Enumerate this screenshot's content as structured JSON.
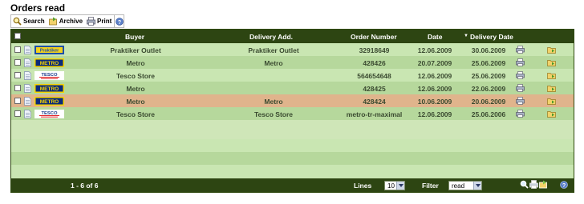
{
  "page_title": "Orders read",
  "toolbar": {
    "search_label": "Search",
    "archive_label": "Archive",
    "print_label": "Print"
  },
  "columns": {
    "buyer": "Buyer",
    "delivery_add": "Delivery Add.",
    "order_number": "Order Number",
    "date": "Date",
    "delivery_date": "Delivery Date",
    "sort_indicator": "▼"
  },
  "rows": [
    {
      "logo": "praktiker",
      "buyer": "Praktiker Outlet",
      "delivery_add": "Praktiker Outlet",
      "order_number": "32918649",
      "date": "12.06.2009",
      "delivery_date": "30.06.2009",
      "bg": "#c9e6b2"
    },
    {
      "logo": "metro",
      "buyer": "Metro",
      "delivery_add": "Metro",
      "order_number": "428426",
      "date": "20.07.2009",
      "delivery_date": "25.06.2009",
      "bg": "#b6d89c"
    },
    {
      "logo": "tesco",
      "buyer": "Tesco Store",
      "delivery_add": "",
      "order_number": "564654648",
      "date": "12.06.2009",
      "delivery_date": "25.06.2009",
      "bg": "#c9e6b2"
    },
    {
      "logo": "metro",
      "buyer": "Metro",
      "delivery_add": "",
      "order_number": "428425",
      "date": "12.06.2009",
      "delivery_date": "22.06.2009",
      "bg": "#b6d89c"
    },
    {
      "logo": "metro",
      "buyer": "Metro",
      "delivery_add": "Metro",
      "order_number": "428424",
      "date": "10.06.2009",
      "delivery_date": "20.06.2009",
      "bg": "#e0b48c"
    },
    {
      "logo": "tesco",
      "buyer": "Tesco Store",
      "delivery_add": "Tesco Store",
      "order_number": "metro-tr-maximal",
      "date": "12.06.2009",
      "delivery_date": "25.06.2006",
      "bg": "#b6d89c"
    }
  ],
  "logos": {
    "praktiker": "Praktiker",
    "metro": "METRO",
    "tesco": "TESCO"
  },
  "footer": {
    "pagination": "1 - 6 of 6",
    "lines_label": "Lines",
    "lines_value": "10",
    "filter_label": "Filter",
    "filter_value": "read"
  },
  "colors": {
    "header_bg": "#2d4512",
    "row_light": "#c9e6b2",
    "row_dark": "#b6d89c",
    "row_highlight": "#e0b48c"
  }
}
